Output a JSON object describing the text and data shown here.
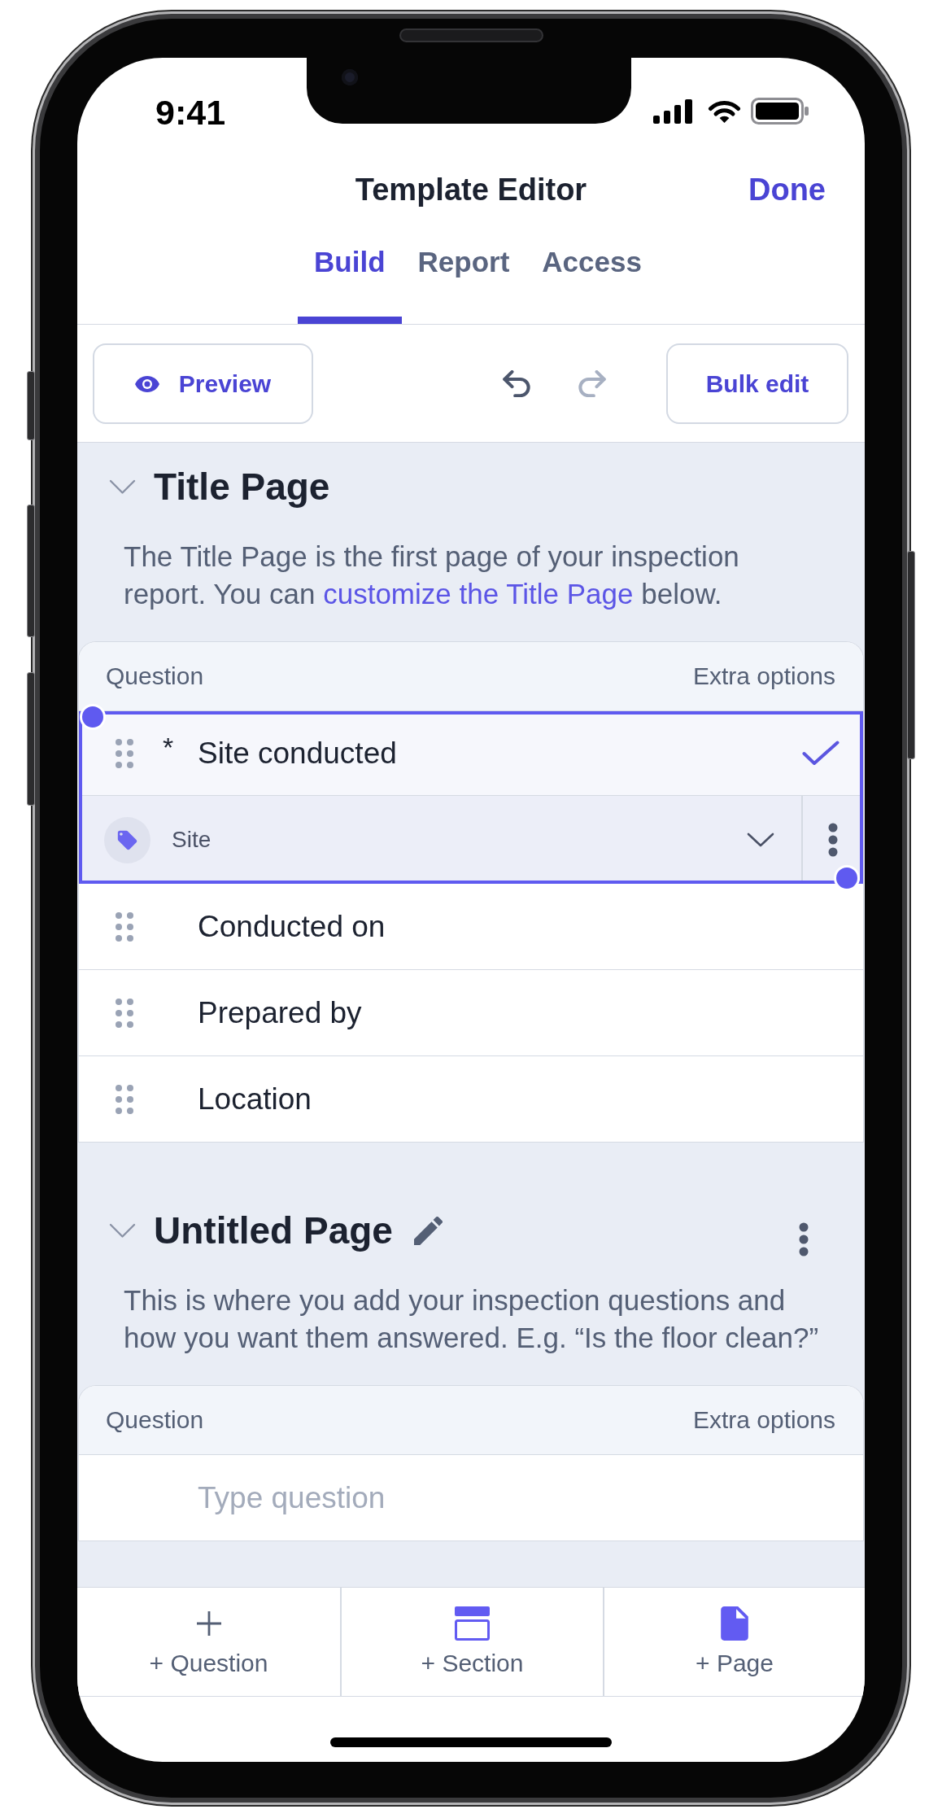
{
  "status_bar": {
    "time": "9:41"
  },
  "header": {
    "title": "Template Editor",
    "action": "Done"
  },
  "tabs": [
    {
      "label": "Build",
      "selected": true
    },
    {
      "label": "Report",
      "selected": false
    },
    {
      "label": "Access",
      "selected": false
    }
  ],
  "toolbar": {
    "preview": "Preview",
    "undo": {
      "disabled": false
    },
    "redo": {
      "disabled": true
    },
    "bulk_edit": "Bulk edit"
  },
  "pages": [
    {
      "kind": "title",
      "title": "Title Page",
      "expanded": true,
      "description": [
        {
          "kind": "text",
          "text": "The Title Page is the first page of your inspection report. You can "
        },
        {
          "kind": "link",
          "text": "customize the Title Page"
        },
        {
          "kind": "text",
          "text": " below."
        }
      ],
      "table": {
        "columns": [
          "Question",
          "Extra options"
        ],
        "questions": [
          {
            "mark": "*",
            "text": "Site conducted",
            "selected": true,
            "response": "Site"
          },
          {
            "text": "Conducted on",
            "selected": false
          },
          {
            "text": "Prepared by",
            "selected": false
          },
          {
            "text": "Location",
            "selected": false
          }
        ]
      }
    },
    {
      "kind": "custom",
      "title": "Untitled Page",
      "expanded": true,
      "description": [
        {
          "kind": "text",
          "text": "This is where you add your inspection questions and how you want them answered. E.g. “Is the floor clean?”"
        }
      ],
      "table": {
        "columns": [
          "Question",
          "Extra options"
        ],
        "new_question": {
          "placeholder": "Type question"
        }
      }
    }
  ],
  "bottom_bar": [
    {
      "kind": "question",
      "label": "+ Question"
    },
    {
      "kind": "section",
      "label": "+ Section"
    },
    {
      "kind": "page",
      "label": "+ Page"
    }
  ]
}
